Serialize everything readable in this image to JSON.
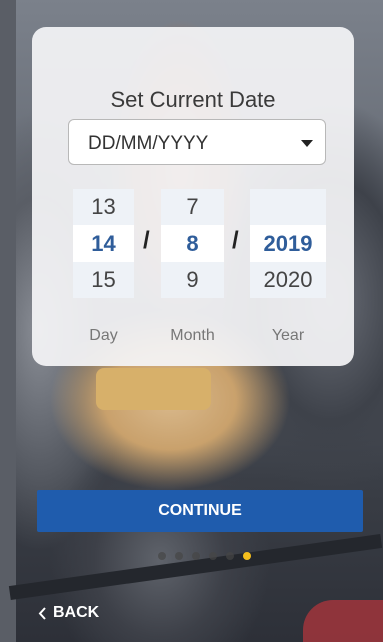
{
  "card": {
    "title": "Set Current Date",
    "format_select": {
      "value": "DD/MM/YYYY"
    },
    "picker": {
      "day": {
        "label": "Day",
        "above": "13",
        "selected": "14",
        "below": "15"
      },
      "month": {
        "label": "Month",
        "above": "7",
        "selected": "8",
        "below": "9"
      },
      "year": {
        "label": "Year",
        "above": "",
        "selected": "2019",
        "below": "2020"
      },
      "separator": "/"
    }
  },
  "actions": {
    "continue_label": "CONTINUE",
    "back_label": "BACK"
  },
  "pagination": {
    "total": 6,
    "active_index": 5
  },
  "colors": {
    "primary": "#1f5cad",
    "selected_text": "#2f5d9a",
    "active_dot": "#f5bf1d"
  }
}
